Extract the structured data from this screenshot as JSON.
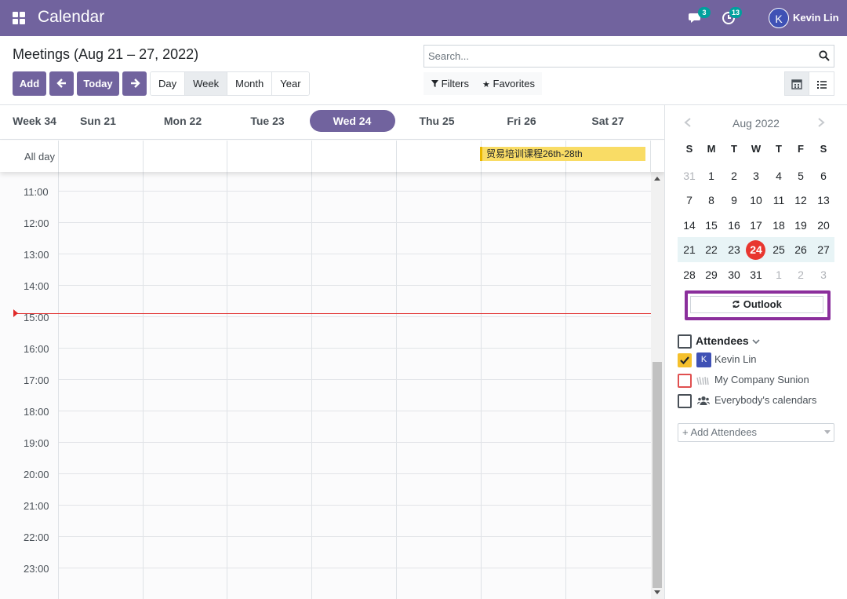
{
  "navbar": {
    "app_title": "Calendar",
    "chat_badge": "3",
    "activity_badge": "13",
    "user_initial": "K",
    "user_name": "Kevin Lin",
    "bg_color": "#71639e"
  },
  "control": {
    "title": "Meetings (Aug 21 – 27, 2022)",
    "add_label": "Add",
    "today_label": "Today",
    "views": [
      "Day",
      "Week",
      "Month",
      "Year"
    ],
    "active_view": "Week",
    "search_placeholder": "Search...",
    "filters_label": "Filters",
    "favorites_label": "Favorites"
  },
  "calendar": {
    "week_label": "Week 34",
    "days": [
      "Sun 21",
      "Mon 22",
      "Tue 23",
      "Wed 24",
      "Thu 25",
      "Fri 26",
      "Sat 27"
    ],
    "today_index": 3,
    "allday_label": "All day",
    "allday_event": "贸易培训课程26th-28th",
    "hours": [
      "11:00",
      "12:00",
      "13:00",
      "14:00",
      "15:00",
      "16:00",
      "17:00",
      "18:00",
      "19:00",
      "20:00",
      "21:00",
      "22:00",
      "23:00"
    ],
    "today_color": "#e8362f"
  },
  "mini_calendar": {
    "month_label": "Aug 2022",
    "dow": [
      "S",
      "M",
      "T",
      "W",
      "T",
      "F",
      "S"
    ],
    "weeks": [
      [
        "31",
        "1",
        "2",
        "3",
        "4",
        "5",
        "6"
      ],
      [
        "7",
        "8",
        "9",
        "10",
        "11",
        "12",
        "13"
      ],
      [
        "14",
        "15",
        "16",
        "17",
        "18",
        "19",
        "20"
      ],
      [
        "21",
        "22",
        "23",
        "24",
        "25",
        "26",
        "27"
      ],
      [
        "28",
        "29",
        "30",
        "31",
        "1",
        "2",
        "3"
      ]
    ],
    "today": "24"
  },
  "sidebar": {
    "outlook_label": "Outlook",
    "attendees_title": "Attendees",
    "attendees": [
      {
        "initial": "K",
        "name": "Kevin Lin",
        "checked": true
      },
      {
        "name": "My Company Sunion",
        "checked": false
      },
      {
        "name": "Everybody's calendars",
        "checked": false
      }
    ],
    "add_attendees_placeholder": "+ Add Attendees"
  }
}
